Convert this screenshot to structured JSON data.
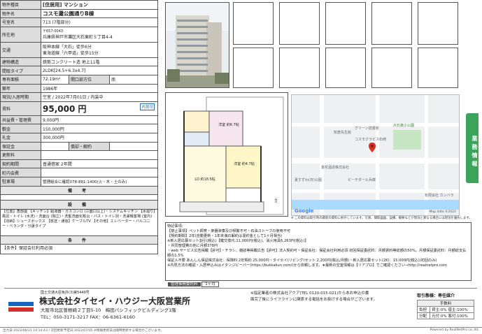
{
  "spec": {
    "type_label": "物件種目",
    "type_value": "[住居用] マンション",
    "name_label": "物件名",
    "name_value": "コスモ灘公園通りB棟",
    "room_label": "号室名",
    "room_value": "713 (7階部分)",
    "addr_label": "所在地",
    "postal": "〒657-0043",
    "addr_value": "兵庫県神戸市灘区大石東町５丁目4-4",
    "access_label": "交通",
    "access_line1": "阪神本線「大石」徒歩6分",
    "access_line2": "東海道線「六甲道」徒歩15分",
    "structure_label": "建物構造",
    "structure_value": "鉄筋コンクリート造 地上11階",
    "layout_label": "間取タイプ",
    "layout_value": "2LDK[24.5+6.3x4.7]",
    "area_label": "専有面積",
    "area_value": "72.19m²",
    "aspect_label": "開口部方位",
    "aspect_value": "南",
    "built_label": "築年",
    "built_value": "1986年",
    "status_label": "現況/入居時期",
    "status_value": "空室 / 2022年7月01日 / 内装中",
    "rent_label": "賃料",
    "rent_value": "95,000 円",
    "rent_badge": "内見可",
    "fee_label": "共益費・管理費",
    "fee_value": "9,000円",
    "deposit_label": "敷金",
    "deposit_value": "150,000円",
    "key_label": "礼金",
    "key_value": "300,000円",
    "guarantee_label": "保証金",
    "guarantee_value": "",
    "amort_label": "償却・解約",
    "amort_value": "",
    "renew_label": "更新料",
    "renew_value": "",
    "contract_label": "契約期間",
    "contract_value": "普通借家 2年間",
    "insurance_label": "町内会費",
    "insurance_value": "",
    "parking_label": "駐車場",
    "parking_value": "管理組合に確認078-881-1400(火・木・土のみ)",
    "bikou_header": "備 考",
    "setsubi_header": "設 備",
    "setsubi_text": "【位置】角部屋 【キッチン】給湯器・ガスコンロ (三面口以上)・システムキッチン 【水廻り】風呂・トイレ (水洗)・洗面台 (独立)・洗髪洗面化粧台・バス・トイレ別・洗濯機置場 (室内) 【収納】シューズボックス 【放送・通信】ケーブルTV 【その他】エレベーター・バルコニー・ベランダ・分譲タイプ",
    "jouken_header": "条 件",
    "jouken_text": "【条件】保証会社利用必須"
  },
  "floorplan": {
    "room1": "洋室 約6.7帖",
    "room2": "洋室 約4.7帖",
    "ldk": "LD 約18.5帖"
  },
  "map": {
    "labels": [
      "大石東小公園",
      "知恵先生館",
      "グリーン読書館",
      "コスモクラビス石崎",
      "金花酒造株式会社",
      "夏すずわ(日)公園",
      "ピーチダール兵庫",
      "有限会社 カンバラ"
    ],
    "google": "Google",
    "data": "Map data ©2022",
    "note": "※ この資料は取引時の最新の資料に依存しています。写真、間取図面、設備、概要などが現況と異なる場合には現況を優先します。"
  },
  "side_tab": "業務情報",
  "remarks": {
    "header": "特記事項:",
    "lines": [
      "【禁止事項】ペット飼育・楽器演奏及び頻繁不可・石油ストーブの使用不可",
      "【契約期間】2年(自動更新・1年未満の解約は違約金として1ヶ月相当)",
      "※新入居応募セット割引(税込)【鍵交換代:11,000円(税込)、消火用具6,263円(税込)】",
      "・共同管理費の他に月額378円",
      "・web サービス広告掲載【許可】・チラシ、雑誌等掲載広告【許可】法人契約可・保証会社：保証会社利用必須 初回保証委託料：月額賃料等総額の50%。月額保証委託料：月額総支払額の1.5%",
      "保証人不要 あんしん保証株式会社：保険料 2年契約 25,000円・タイセイ(リビング)セット 2,200円(税込/月額)・新入居応募セット(2K)：15,000円(税込)(初回のみ)",
      "※内見方法の確認・入居申込みはイタンジビーバー(https://bukkakun.com/)から依頼します。★最新の空室情報は【リアプロ】でご確認ください→http://realnetpro.com"
    ],
    "commission_label": "管理事務委託料",
    "commission_value": "1ヶ月"
  },
  "company": {
    "license": "国土交通大臣免許(3)第5449号",
    "name": "株式会社タイセイ・ハウジー大阪営業所",
    "address": "大阪市北区曽根崎２丁目5-10　梅田パシフィックビルディング1階",
    "tel": "TEL：050-3171-3217 FAX：06-6361-6160"
  },
  "contact": {
    "line1": "※指定業者の株式会社アクア(TEL 0120-015-021)から本お申込の書",
    "line2": "面完了後にライフラインに関係する電話をお掛けする場合がございます。"
  },
  "fees": {
    "title": "取引態様：専任媒介",
    "header": "手数料",
    "row1_label": "負担",
    "row1_value": "貸主:0% 借主:100%",
    "row2_label": "分配",
    "row2_value": "元付:0% 客付:100%"
  },
  "footer": {
    "left": "出力日:2022/06/21 10:14:43 / 次回更新予定日:2022/07/05 ※情報更新日は随時更新する場合がございます。",
    "right": "Powered by RealNetPro co.,ltd."
  }
}
